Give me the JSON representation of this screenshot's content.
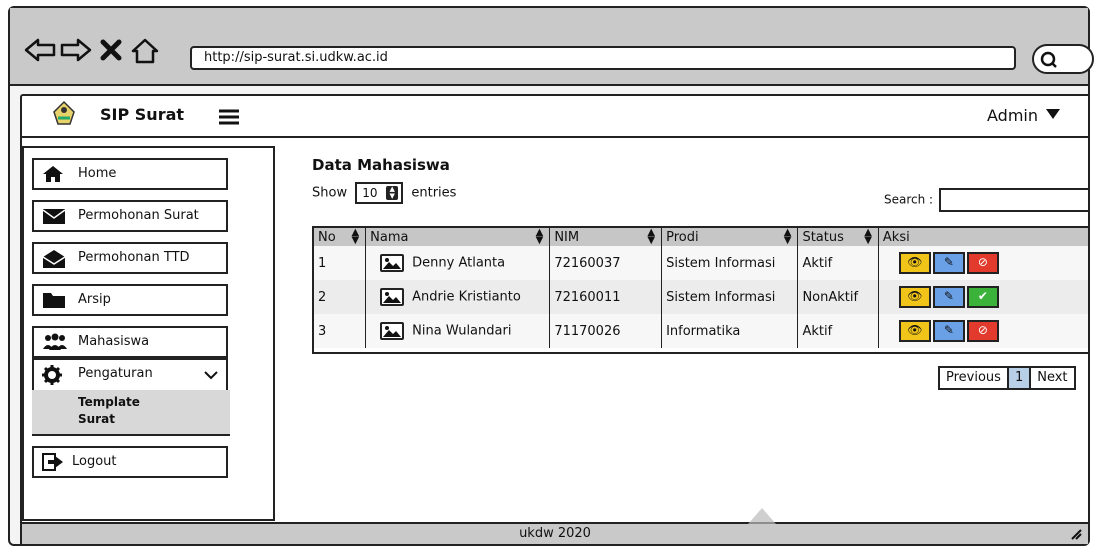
{
  "browser": {
    "url": "http://sip-surat.si.udkw.ac.id",
    "icons": [
      "back-arrow-icon",
      "forward-arrow-icon",
      "close-x-icon",
      "home-icon",
      "search-icon"
    ]
  },
  "header": {
    "brand": "SIP Surat",
    "user": "Admin"
  },
  "sidebar": {
    "items": [
      {
        "label": "Home",
        "icon": "home-icon"
      },
      {
        "label": "Permohonan Surat",
        "icon": "envelope-icon"
      },
      {
        "label": "Permohonan TTD",
        "icon": "envelope-open-icon"
      },
      {
        "label": "Arsip",
        "icon": "folder-icon"
      },
      {
        "label": "Mahasiswa",
        "icon": "users-icon"
      },
      {
        "label": "Pengaturan",
        "icon": "gear-icon"
      },
      {
        "label": "Logout",
        "icon": "sign-out-icon"
      }
    ],
    "submenu": [
      "Template",
      "Surat"
    ]
  },
  "main": {
    "title": "Data Mahasiswa",
    "show_label": "Show",
    "entries_value": "10",
    "entries_label": "entries",
    "search_label": "Search :",
    "columns": [
      "No",
      "Nama",
      "NIM",
      "Prodi",
      "Status",
      "Aksi"
    ],
    "rows": [
      {
        "no": "1",
        "nama": "Denny Atlanta",
        "nim": "72160037",
        "prodi": "Sistem Informasi",
        "status": "Aktif",
        "toggle": "deactivate"
      },
      {
        "no": "2",
        "nama": "Andrie Kristianto",
        "nim": "72160011",
        "prodi": "Sistem Informasi",
        "status": "NonAktif",
        "toggle": "activate"
      },
      {
        "no": "3",
        "nama": "Nina Wulandari",
        "nim": "71170026",
        "prodi": "Informatika",
        "status": "Aktif",
        "toggle": "deactivate"
      }
    ],
    "pagination": {
      "previous": "Previous",
      "page": "1",
      "next": "Next"
    }
  },
  "footer": {
    "text": "ukdw 2020"
  },
  "colors": {
    "chrome": "#c9c9c9",
    "view": "#f0c419",
    "edit": "#6aa0e6",
    "deactivate": "#e23b2e",
    "activate": "#3bb33b"
  }
}
